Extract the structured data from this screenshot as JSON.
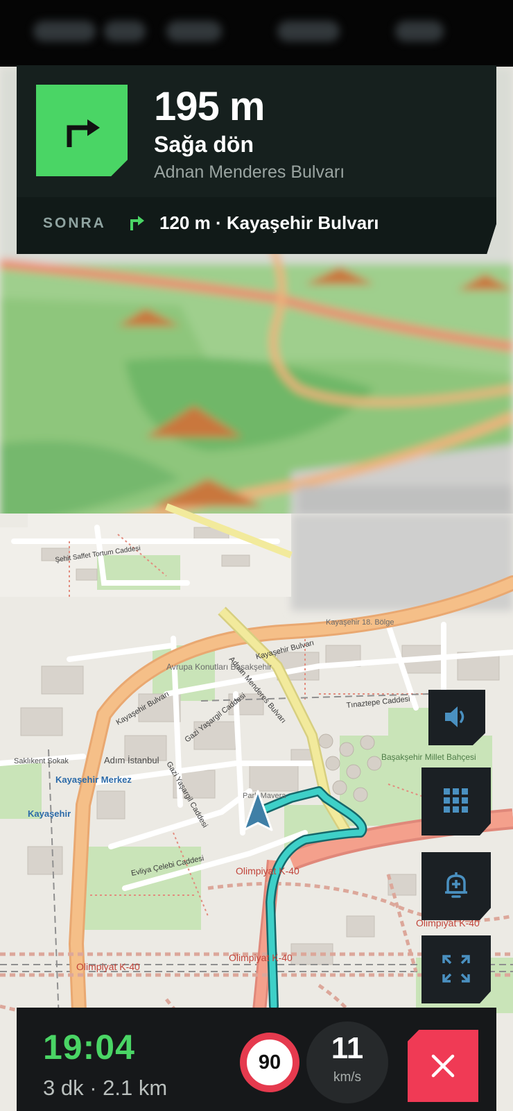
{
  "maneuver": {
    "icon": "turn-right-icon",
    "distance": "195 m",
    "instruction": "Sağa dön",
    "street": "Adnan Menderes Bulvarı",
    "accent_color": "#4ad565"
  },
  "next_step": {
    "label": "SONRA",
    "icon": "turn-right-icon",
    "text": "120 m · Kayaşehir Bulvarı"
  },
  "map": {
    "labels": {
      "kayasehir_bulvari_1": "Kayaşehir Bulvarı",
      "kayasehir_bulvari_2": "Kayaşehir Bulvarı",
      "adnan_menderes": "Adnan Menderes Bulvarı",
      "tinaztepe": "Tınaztepe Caddesi",
      "gazi_yasargil_1": "Gazi Yaşargil Caddesi",
      "gazi_yasargil_2": "Gazi Yaşargil Caddesi",
      "evliya_celebi": "Evliya Çelebi Caddesi",
      "avrupa_konutlari": "Avrupa Konutları Başakşehir",
      "kayasehir_merkez": "Kayaşehir Merkez",
      "kayasehir": "Kayaşehir",
      "adim_istanbul": "Adım İstanbul",
      "sakli_kent": "Saklıkent Sokak",
      "basaksehir_millet": "Başakşehir Millet Bahçesi",
      "kayasehir_bolge": "Kayaşehir 18. Bölge",
      "park_mavera": "Park Mavera",
      "olimpiyat_1": "Olimpiyat K-40",
      "olimpiyat_2": "Olimpiyat K-40",
      "olimpiyat_3": "Olimpiyat K-40",
      "olimpiyat_4": "Olimpiyat K-40",
      "sehit_tortum": "Şehit Saffet Tortum Caddesi"
    },
    "route_color": "#3ed0c8",
    "position_marker": "navigation-arrow-icon"
  },
  "controls": {
    "sound": "volume-icon",
    "grid": "grid-icon",
    "alert": "add-alert-bell-icon",
    "fullscreen": "fullscreen-icon"
  },
  "trip": {
    "eta": "19:04",
    "info": "3 dk · 2.1 km",
    "speed_limit": "90",
    "speed": "11",
    "speed_unit": "km/s",
    "close_icon": "close-icon",
    "close_color": "#f03a55"
  }
}
